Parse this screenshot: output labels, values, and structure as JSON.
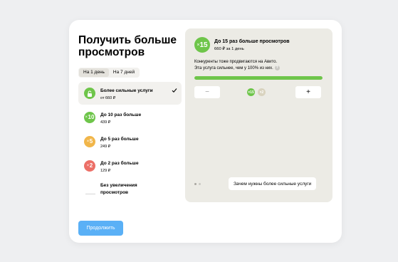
{
  "title": "Получить больше просмотров",
  "periods": [
    {
      "label": "На 1 день",
      "active": true
    },
    {
      "label": "На 7 дней",
      "active": false
    }
  ],
  "options": [
    {
      "badge": "",
      "title": "Более сильные услуги",
      "price": "от 660 ₽",
      "color": "#6ec54a",
      "selected": true,
      "icon": "lock-icon"
    },
    {
      "badge": "10",
      "title": "До 10 раз больше",
      "price": "439 ₽",
      "color": "#6ec54a",
      "selected": false
    },
    {
      "badge": "5",
      "title": "До 5 раз больше",
      "price": "249 ₽",
      "color": "#f1b64a",
      "selected": false
    },
    {
      "badge": "2",
      "title": "До 2 раз больше",
      "price": "129 ₽",
      "color": "#ec6f67",
      "selected": false
    },
    {
      "title": "Без увеличения просмотров"
    }
  ],
  "continue_label": "Продолжить",
  "panel": {
    "badge": "15",
    "title": "До 15 раз больше просмотров",
    "subtitle": "660 ₽ за 1 день",
    "desc_line1": "Конкуренты тоже продвигаются на Авито.",
    "desc_line2": "Эта услуга сильнее, чем у 100% из них.",
    "help": "?",
    "progress_percent": 100,
    "minus_label": "−",
    "plus_label": "+",
    "mini_badges": [
      {
        "text": "×15",
        "color": "#6ec54a"
      },
      {
        "text": "×2",
        "color": "#d9d3bf"
      }
    ],
    "dots": [
      {
        "active": true
      },
      {
        "active": false
      }
    ],
    "why_label": "Зачем нужны более сильные услуги"
  },
  "colors": {
    "accent": "#5ab0f6",
    "green": "#6ec54a",
    "orange": "#f1b64a",
    "red": "#ec6f67"
  }
}
